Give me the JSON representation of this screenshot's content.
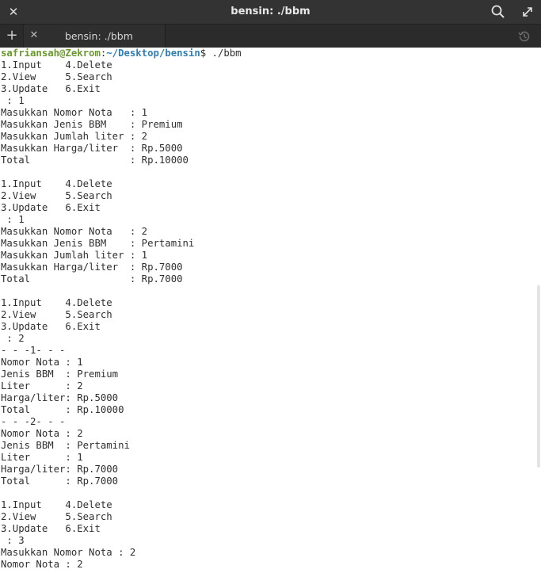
{
  "window": {
    "title": "bensin: ./bbm",
    "close_glyph": "✕",
    "search_icon": "search-icon",
    "maximize_icon": "maximize-icon"
  },
  "tabs": {
    "new_tab_glyph": "+",
    "close_glyph": "✕",
    "items": [
      {
        "label": "bensin: ./bbm"
      }
    ],
    "history_icon": "history-icon"
  },
  "terminal": {
    "prompt": {
      "user_host": "safriansah@Zekrom",
      "separator": ":",
      "path": "~/Desktop/bensin",
      "symbol": "$",
      "command": " ./bbm"
    },
    "lines": [
      "1.Input    4.Delete",
      "2.View     5.Search",
      "3.Update   6.Exit",
      " : 1",
      "Masukkan Nomor Nota   : 1",
      "Masukkan Jenis BBM    : Premium",
      "Masukkan Jumlah liter : 2",
      "Masukkan Harga/liter  : Rp.5000",
      "Total                 : Rp.10000",
      "",
      "1.Input    4.Delete",
      "2.View     5.Search",
      "3.Update   6.Exit",
      " : 1",
      "Masukkan Nomor Nota   : 2",
      "Masukkan Jenis BBM    : Pertamini",
      "Masukkan Jumlah liter : 1",
      "Masukkan Harga/liter  : Rp.7000",
      "Total                 : Rp.7000",
      "",
      "1.Input    4.Delete",
      "2.View     5.Search",
      "3.Update   6.Exit",
      " : 2",
      "- - -1- - -",
      "Nomor Nota : 1",
      "Jenis BBM  : Premium",
      "Liter      : 2",
      "Harga/liter: Rp.5000",
      "Total      : Rp.10000",
      "- - -2- - -",
      "Nomor Nota : 2",
      "Jenis BBM  : Pertamini",
      "Liter      : 1",
      "Harga/liter: Rp.7000",
      "Total      : Rp.7000",
      "",
      "1.Input    4.Delete",
      "2.View     5.Search",
      "3.Update   6.Exit",
      " : 3",
      "Masukkan Nomor Nota : 2",
      "Nomor Nota : 2"
    ]
  }
}
